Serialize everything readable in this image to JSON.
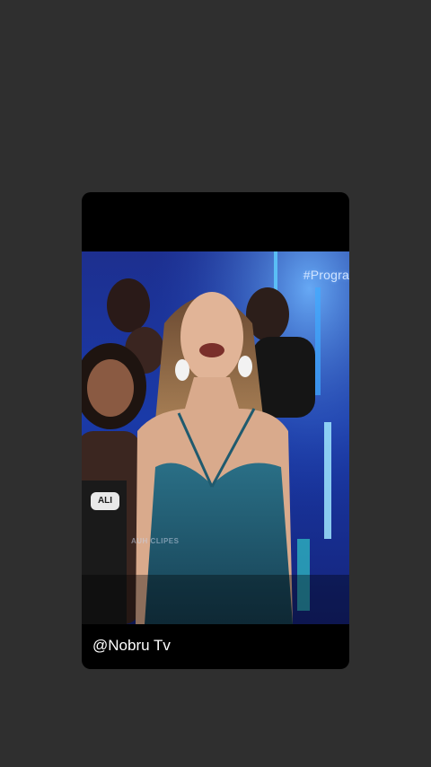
{
  "video": {
    "hashtag": "#Progra",
    "name_tag": "ALI",
    "watermark": "AUH CLIPES"
  },
  "caption": {
    "channel": "@Nobru Tv"
  },
  "colors": {
    "background": "#2f2f2f",
    "card": "#000000",
    "stage_blue": "#1a3aa8",
    "dress": "#1f5a6e"
  },
  "icons": []
}
